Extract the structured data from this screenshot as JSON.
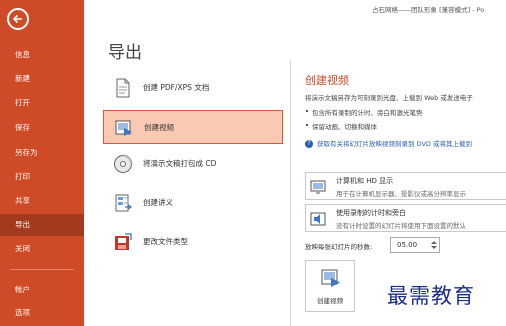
{
  "window": {
    "title": "占石网络——团队形象 [兼容模式] - Po"
  },
  "sidebar": {
    "items": [
      {
        "label": "信息"
      },
      {
        "label": "新建"
      },
      {
        "label": "打开"
      },
      {
        "label": "保存"
      },
      {
        "label": "另存为"
      },
      {
        "label": "打印"
      },
      {
        "label": "共享"
      },
      {
        "label": "导出"
      },
      {
        "label": "关闭"
      },
      {
        "label": "帐户"
      },
      {
        "label": "选项"
      }
    ]
  },
  "main": {
    "title": "导出",
    "options": [
      {
        "label": "创建 PDF/XPS 文档",
        "icon": "pdf-document-icon"
      },
      {
        "label": "创建视频",
        "icon": "video-icon"
      },
      {
        "label": "将演示文稿打包成 CD",
        "icon": "cd-icon"
      },
      {
        "label": "创建讲义",
        "icon": "handout-icon"
      },
      {
        "label": "更改文件类型",
        "icon": "change-file-type-icon"
      }
    ]
  },
  "detail": {
    "title": "创建视频",
    "description": "将演示文稿另存为可刻录到光盘、上载到 Web 或发送电子",
    "bullets": [
      "包含所有录制的计时、旁白和激光笔势",
      "保留动画、切换和媒体"
    ],
    "info_link": "获取有关将幻灯片放映视频刻录到 DVD 或将其上载到",
    "quality_dropdown": {
      "title": "计算机和 HD 显示",
      "subtitle": "用于在计算机显示器、投影仪或高分辨率显示"
    },
    "timing_dropdown": {
      "title": "使用录制的计时和旁白",
      "subtitle": "没有计时设置的幻灯片将使用下面设置的默认"
    },
    "seconds_label": "放映每张幻灯片的秒数:",
    "seconds_value": "05.00",
    "create_button_label": "创建视频"
  },
  "watermark": "最需教育",
  "colors": {
    "accent": "#cf4a26",
    "sidebar_active": "#a33a1d",
    "selected_bg": "#f9c9b3",
    "link": "#2a5caa"
  }
}
